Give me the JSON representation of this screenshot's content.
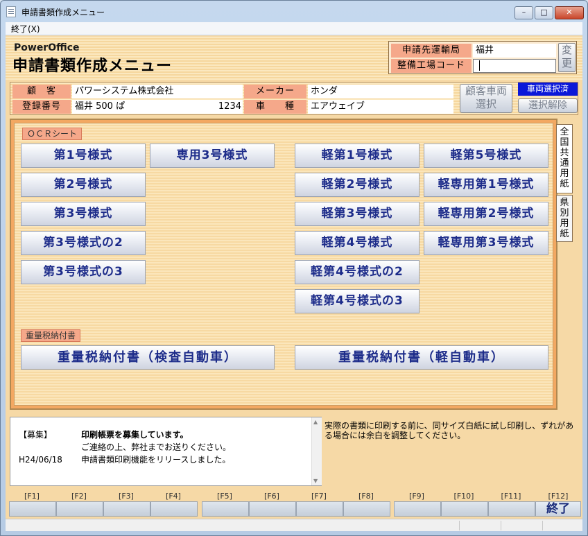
{
  "window": {
    "title": "申請書類作成メニュー"
  },
  "menu": {
    "exit": "終了(X)"
  },
  "header": {
    "brand_small": "PowerOffice",
    "brand_title": "申請書類作成メニュー",
    "transport_bureau_label": "申請先運輸局",
    "transport_bureau_value": "福井",
    "factory_code_label": "整備工場コード",
    "factory_code_value": "",
    "change_button": "変更"
  },
  "customer": {
    "customer_label": "顧　客",
    "customer_value": "パワーシステム株式会社",
    "maker_label": "メーカー",
    "maker_value": "ホンダ",
    "reg_label": "登録番号",
    "reg_value": "福井 500 ぱ",
    "reg_number": "1234",
    "model_label": "車　　種",
    "model_value": "エアウェイブ",
    "select_vehicle_button": "顧客車両選択",
    "vehicle_selected_badge": "車両選択済",
    "clear_selection_button": "選択解除"
  },
  "tabs": {
    "national": "全国共通用紙",
    "prefecture": "県別用紙"
  },
  "ocr": {
    "section_label": "ＯＣＲシート",
    "forms": {
      "f1": "第1号様式",
      "f2": "第2号様式",
      "f3": "第3号様式",
      "f3_2": "第3号様式の2",
      "f3_3": "第3号様式の3",
      "s3": "専用3号様式",
      "k1": "軽第1号様式",
      "k2": "軽第2号様式",
      "k3": "軽第3号様式",
      "k4": "軽第4号様式",
      "k4_2": "軽第4号様式の2",
      "k4_3": "軽第4号様式の3",
      "k5": "軽第5号様式",
      "ks1": "軽専用第1号様式",
      "ks2": "軽専用第2号様式",
      "ks3": "軽専用第3号様式"
    }
  },
  "tax": {
    "section_label": "重量税納付書",
    "inspection_car": "重量税納付書（検査自動車）",
    "light_car": "重量税納付書（軽自動車）"
  },
  "news": {
    "row1_tag": "【募集】",
    "row1_text": "印刷帳票を募集しています。",
    "row2_text": "ご連絡の上、弊社までお送りください。",
    "row3_date": "H24/06/18",
    "row3_text": "申請書類印刷機能をリリースしました。"
  },
  "notice": "実際の書類に印刷する前に、同サイズ白紙に試し印刷し、ずれがある場合には余白を調整してください。",
  "fkeys": {
    "labels": [
      "[F1]",
      "[F2]",
      "[F3]",
      "[F4]",
      "[F5]",
      "[F6]",
      "[F7]",
      "[F8]",
      "[F9]",
      "[F10]",
      "[F11]",
      "[F12]"
    ],
    "f12_action": "終了"
  }
}
